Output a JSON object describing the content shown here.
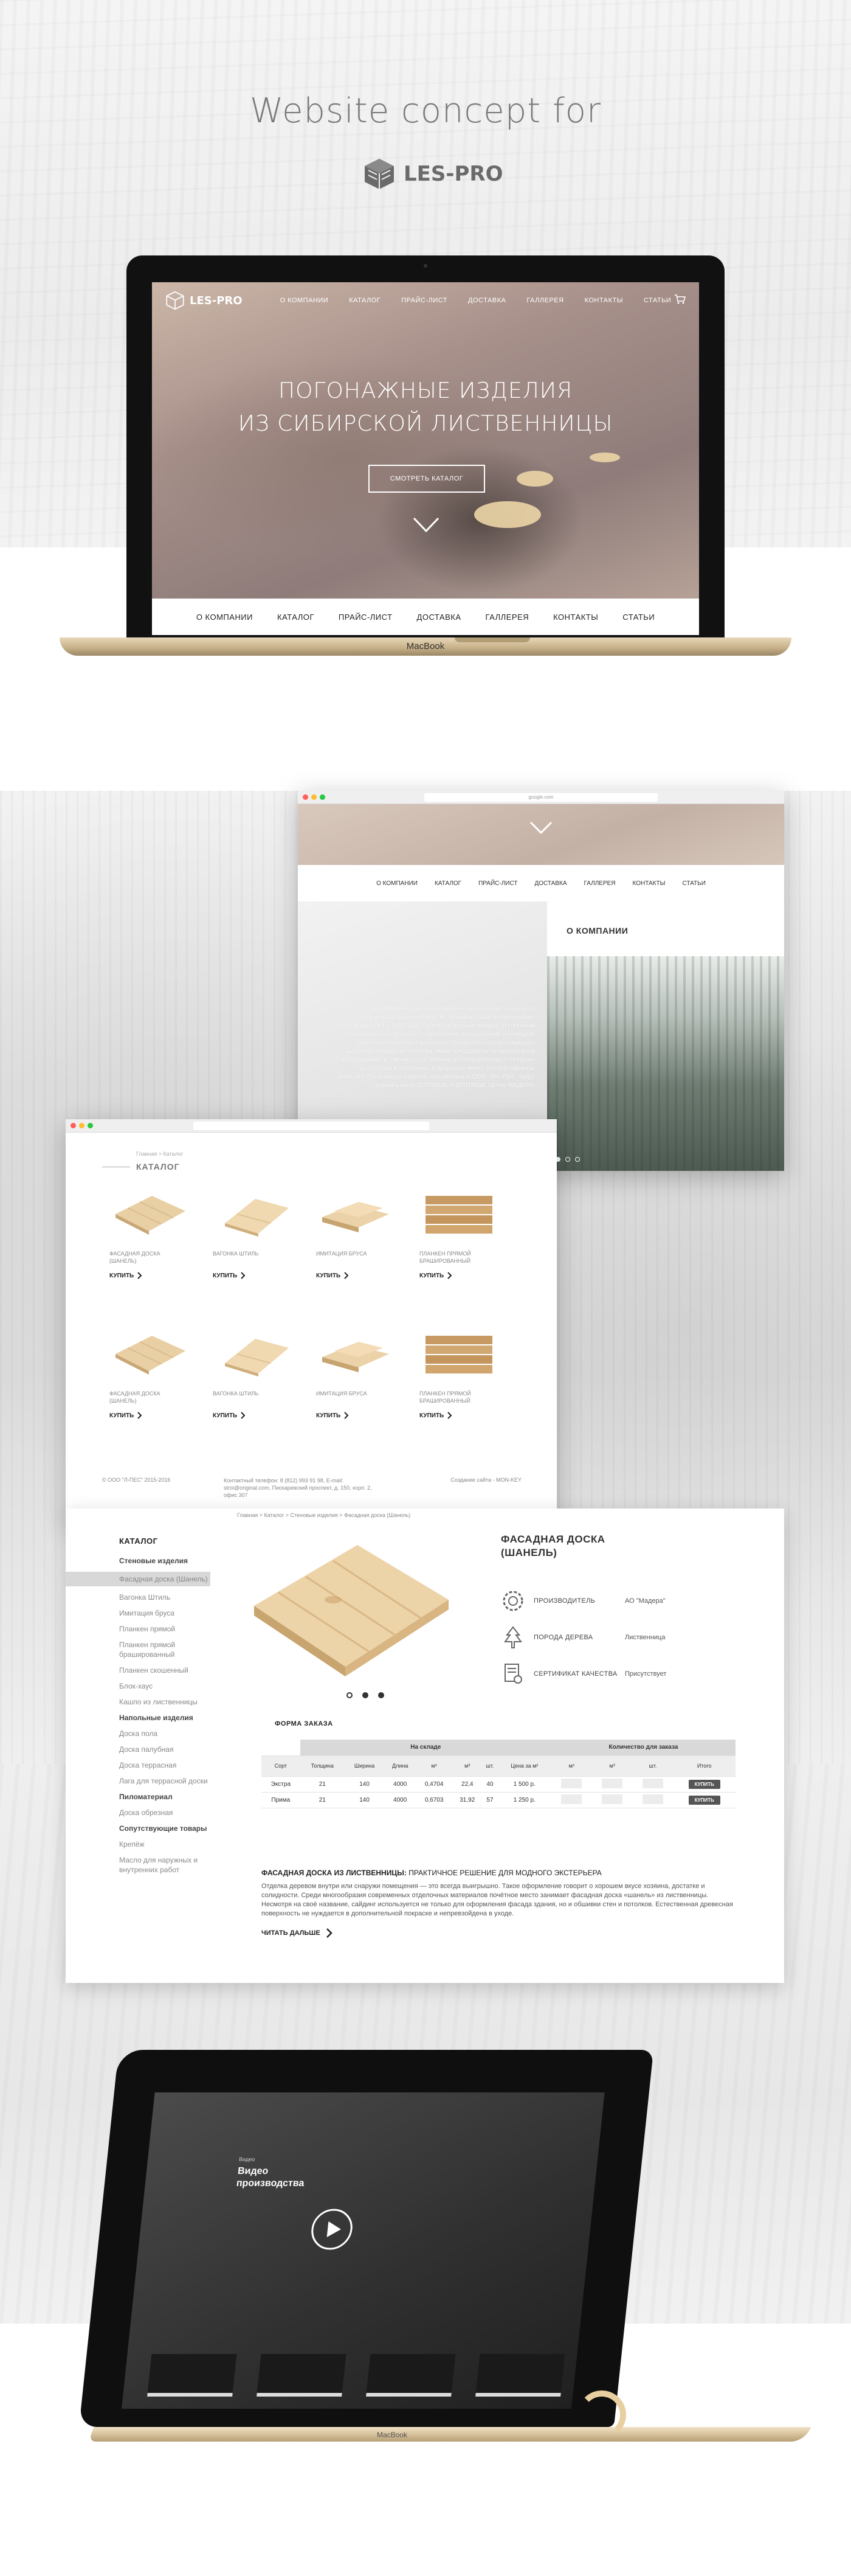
{
  "header": {
    "concept_title": "Website concept for",
    "brand_name": "LES-PRO"
  },
  "laptop1": {
    "logo_text": "LES-PRO",
    "menu": [
      "О КОМПАНИИ",
      "КАТАЛОГ",
      "ПРАЙС-ЛИСТ",
      "ДОСТАВКА",
      "ГАЛЛЕРЕЯ",
      "КОНТАКТЫ",
      "СТАТЬИ"
    ],
    "hero_line1": "ПОГОНАЖНЫЕ ИЗДЕЛИЯ",
    "hero_line2": "ИЗ СИБИРСКОЙ ЛИСТВЕННИЦЫ",
    "hero_button": "СМОТРЕТЬ КАТАЛОГ",
    "bottom_menu": [
      "О КОМПАНИИ",
      "КАТАЛОГ",
      "ПРАЙС-ЛИСТ",
      "ДОСТАВКА",
      "ГАЛЛЕРЕЯ",
      "КОНТАКТЫ",
      "СТАТЬИ"
    ],
    "base_label": "MacBook"
  },
  "window_about": {
    "url": "google.com",
    "menu": [
      "О КОМПАНИИ",
      "КАТАЛОГ",
      "ПРАЙС-ЛИСТ",
      "ДОСТАВКА",
      "ГАЛЛЕРЕЯ",
      "КОНТАКТЫ",
      "СТАТЬИ"
    ],
    "heading": "О КОМПАНИИ",
    "text": "АО \"МАДЕРА\" является одним из крупнейших заводов по производству сибирской лиственницы, одно из крупнейших производителей с 1990 года. Производственные мощности компании находятся в г.Иркутске, современное оборудование и немецкие технологии позволяют выпускать продукцию, соответствующую высоким стандартам качества. Наше предприятие оснащено всем необходимым, в том числе системами лесопереработки от Погрузки до отгрузки в Компанию, а продукция имеет все сертификаты качества. Погонажные изделия, поставленные ООО \"Лес-Про\", будут держать ваше ОПТОВЫЕ И ОПТОВЫЕ ЦЕНЫ МАДЕРА."
  },
  "window_catalog": {
    "breadcrumb": "Главная > Каталог",
    "title": "КАТАЛОГ",
    "buy_label": "КУПИТЬ",
    "items": [
      "ФАСАДНАЯ ДОСКА (ШАНЕЛЬ)",
      "ВАГОНКА ШТИЛЬ",
      "ИМИТАЦИЯ БРУСА",
      "ПЛАНКЕН ПРЯМОЙ БРАШИРОВАННЫЙ",
      "ФАСАДНАЯ ДОСКА (ШАНЕЛЬ)",
      "ВАГОНКА ШТИЛЬ",
      "ИМИТАЦИЯ БРУСА",
      "ПЛАНКЕН ПРЯМОЙ БРАШИРОВАННЫЙ"
    ],
    "footer_copyright": "© ООО \"Л-ПЕС\" 2015-2016",
    "footer_contacts": "Контактный телефон: 8 (812) 993 91 98, E-mail: stroi@original.com, Пискаревский проспект, д. 150, корп. 2, офис 307",
    "footer_credit": "Создание сайта - MON-KEY"
  },
  "window_product": {
    "crumb": "Главная > Каталог > Стеновые изделия > Фасадная доска (Шанель)",
    "sidebar_title": "КАТАЛОГ",
    "sidebar": [
      {
        "label": "Стеновые изделия",
        "kind": "group"
      },
      {
        "label": "Фасадная доска (Шанель)",
        "kind": "active"
      },
      {
        "label": "Вагонка Штиль",
        "kind": "item"
      },
      {
        "label": "Имитация бруса",
        "kind": "item"
      },
      {
        "label": "Планкен прямой",
        "kind": "item"
      },
      {
        "label": "Планкен прямой брашированный",
        "kind": "item"
      },
      {
        "label": "Планкен скошенный",
        "kind": "item"
      },
      {
        "label": "Блок-хаус",
        "kind": "item"
      },
      {
        "label": "Кашпо из лиственницы",
        "kind": "item"
      },
      {
        "label": "Напольные изделия",
        "kind": "group"
      },
      {
        "label": "Доска пола",
        "kind": "item"
      },
      {
        "label": "Доска палубная",
        "kind": "item"
      },
      {
        "label": "Доска террасная",
        "kind": "item"
      },
      {
        "label": "Лага для террасной доски",
        "kind": "item"
      },
      {
        "label": "Пиломатериал",
        "kind": "group"
      },
      {
        "label": "Доска обрезная",
        "kind": "item"
      },
      {
        "label": "Сопутствующие товары",
        "kind": "group"
      },
      {
        "label": "Крепёж",
        "kind": "item"
      },
      {
        "label": "Масло для наружных и внутренних работ",
        "kind": "item"
      }
    ],
    "title_line1": "ФАСАДНАЯ ДОСКА",
    "title_line2": "(ШАНЕЛЬ)",
    "attributes": [
      {
        "icon": "gear-icon",
        "label": "ПРОИЗВОДИТЕЛЬ",
        "value": "АО \"Мадера\""
      },
      {
        "icon": "tree-icon",
        "label": "ПОРОДА ДЕРЕВА",
        "value": "Лиственница"
      },
      {
        "icon": "certificate-icon",
        "label": "СЕРТИФИКАТ КАЧЕСТВА",
        "value": "Присутствует"
      }
    ],
    "order_title": "ФОРМА ЗАКАЗА",
    "group_stock": "На складе",
    "group_order": "Количество для заказа",
    "columns": [
      "Сорт",
      "Толщина",
      "Ширина",
      "Длина",
      "м²",
      "м³",
      "шт.",
      "Цена за м²",
      "м²",
      "м³",
      "шт.",
      "Итого"
    ],
    "rows": [
      {
        "grade": "Экстра",
        "thickness": "21",
        "width": "140",
        "length": "4000",
        "m2": "0,4704",
        "m3": "22,4",
        "pcs": "40",
        "price": "1 500 р."
      },
      {
        "grade": "Прима",
        "thickness": "21",
        "width": "140",
        "length": "4000",
        "m2": "0,6703",
        "m3": "31,92",
        "pcs": "57",
        "price": "1 250 р."
      }
    ],
    "buy_label": "КУПИТЬ",
    "desc_title_bold": "ФАСАДНАЯ ДОСКА ИЗ ЛИСТВЕННИЦЫ:",
    "desc_title_rest": "ПРАКТИЧНОЕ РЕШЕНИЕ ДЛЯ МОДНОГО ЭКСТЕРЬЕРА",
    "desc_body": "Отделка деревом внутри или снаружи помещения — это всегда выигрышно. Такое оформление говорит о хорошем вкусе хозяина, достатке и солидности. Среди многообразия современных отделочных материалов почётное место занимает фасадная доска «шанель» из лиственницы. Несмотря на своё название, сайдинг используется не только для оформления фасада здания, но и обшивки стен и потолков. Естественная древесная поверхность не нуждается в дополнительной покраске и непревзойдена в уходе.",
    "read_more": "ЧИТАТЬ ДАЛЬШЕ"
  },
  "laptop2": {
    "video_small": "Видео",
    "video_title_1": "Видео",
    "video_title_2": "производства",
    "base_label": "MacBook"
  },
  "colors": {
    "accent_dark": "#333333",
    "wood_light": "#e8cf9f",
    "laptop_gold": "#d6c19a"
  }
}
